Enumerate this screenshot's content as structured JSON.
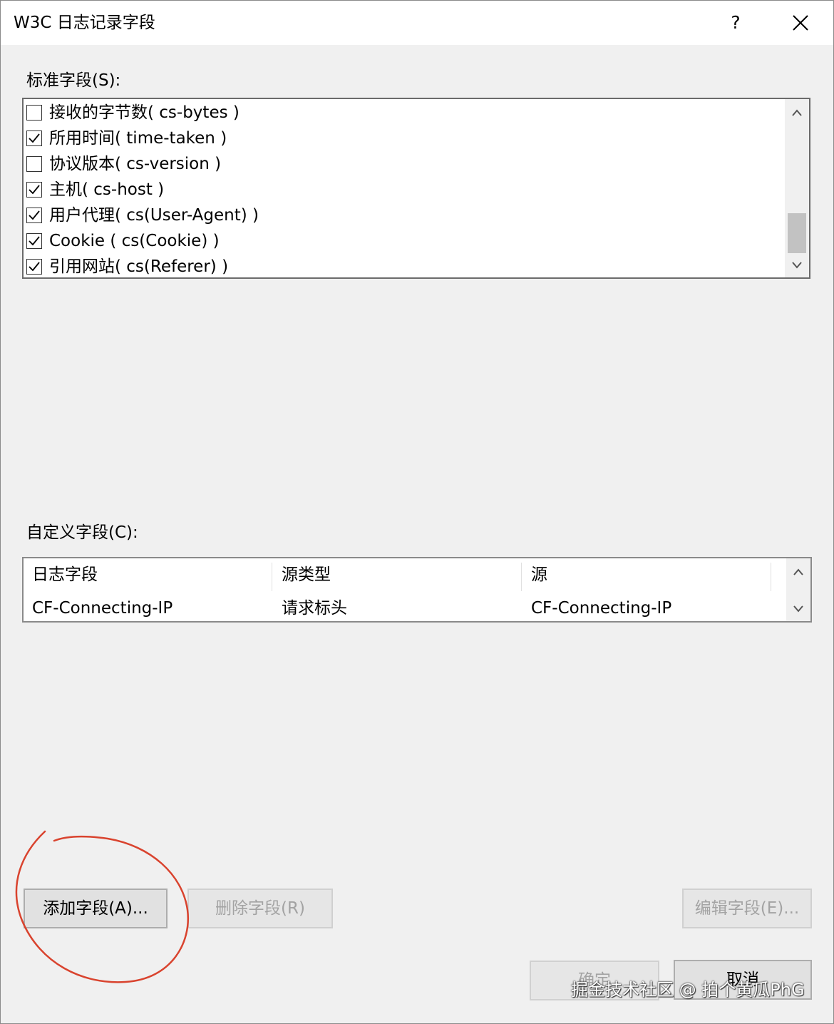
{
  "dialog": {
    "title": "W3C 日志记录字段",
    "help_label": "?",
    "close_icon": "close-icon"
  },
  "standard_fields": {
    "label": "标准字段(S):",
    "items": [
      {
        "label": "接收的字节数( cs-bytes )",
        "checked": false
      },
      {
        "label": "所用时间( time-taken )",
        "checked": true
      },
      {
        "label": "协议版本( cs-version )",
        "checked": false
      },
      {
        "label": "主机( cs-host )",
        "checked": true
      },
      {
        "label": "用户代理( cs(User-Agent) )",
        "checked": true
      },
      {
        "label": "Cookie ( cs(Cookie) )",
        "checked": true
      },
      {
        "label": "引用网站( cs(Referer) )",
        "checked": true
      }
    ]
  },
  "custom_fields": {
    "label": "自定义字段(C):",
    "columns": [
      "日志字段",
      "源类型",
      "源"
    ],
    "rows": [
      [
        "CF-Connecting-IP",
        "请求标头",
        "CF-Connecting-IP"
      ]
    ]
  },
  "buttons": {
    "add_field": "添加字段(A)...",
    "remove_field": "删除字段(R)",
    "edit_field": "编辑字段(E)...",
    "ok": "确定",
    "cancel": "取消"
  },
  "watermark": "掘金技术社区 @ 拍个黄瓜PhG",
  "colors": {
    "annotation_circle": "#d9432e",
    "dialog_background": "#f0f0f0"
  }
}
